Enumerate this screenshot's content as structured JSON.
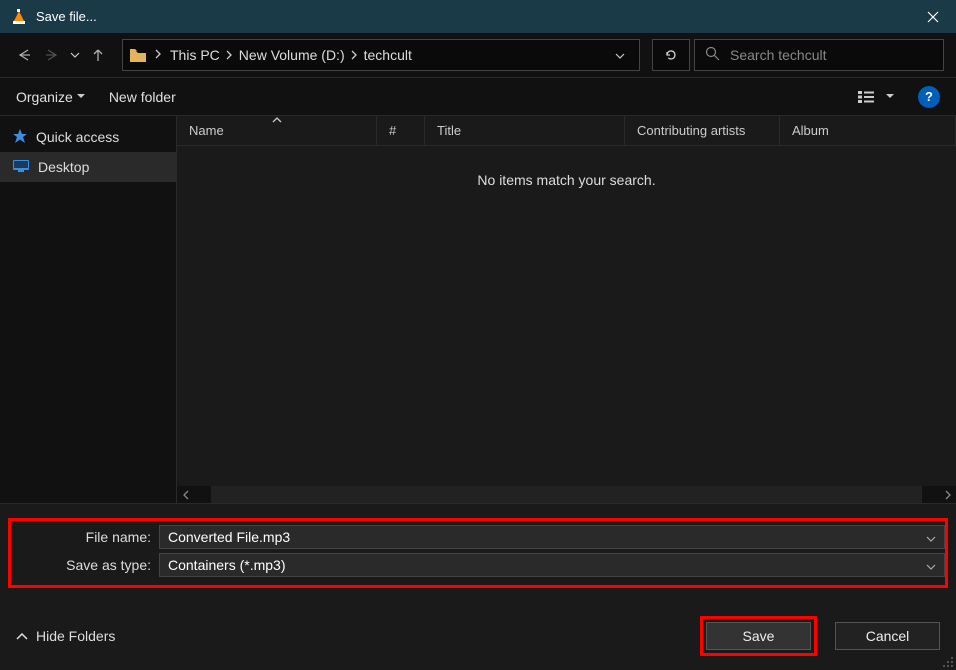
{
  "titlebar": {
    "title": "Save file..."
  },
  "breadcrumbs": {
    "items": [
      "This PC",
      "New Volume (D:)",
      "techcult"
    ]
  },
  "search": {
    "placeholder": "Search techcult"
  },
  "toolbar": {
    "organize": "Organize",
    "new_folder": "New folder",
    "help": "?"
  },
  "sidebar": {
    "quick_access": "Quick access",
    "desktop": "Desktop"
  },
  "columns": {
    "name": "Name",
    "hash": "#",
    "title": "Title",
    "artists": "Contributing artists",
    "album": "Album"
  },
  "content": {
    "empty_message": "No items match your search."
  },
  "fields": {
    "filename_label": "File name:",
    "filename_value": "Converted File.mp3",
    "saveas_label": "Save as type:",
    "saveas_value": "Containers (*.mp3)"
  },
  "buttons": {
    "hide_folders": "Hide Folders",
    "save": "Save",
    "cancel": "Cancel"
  }
}
